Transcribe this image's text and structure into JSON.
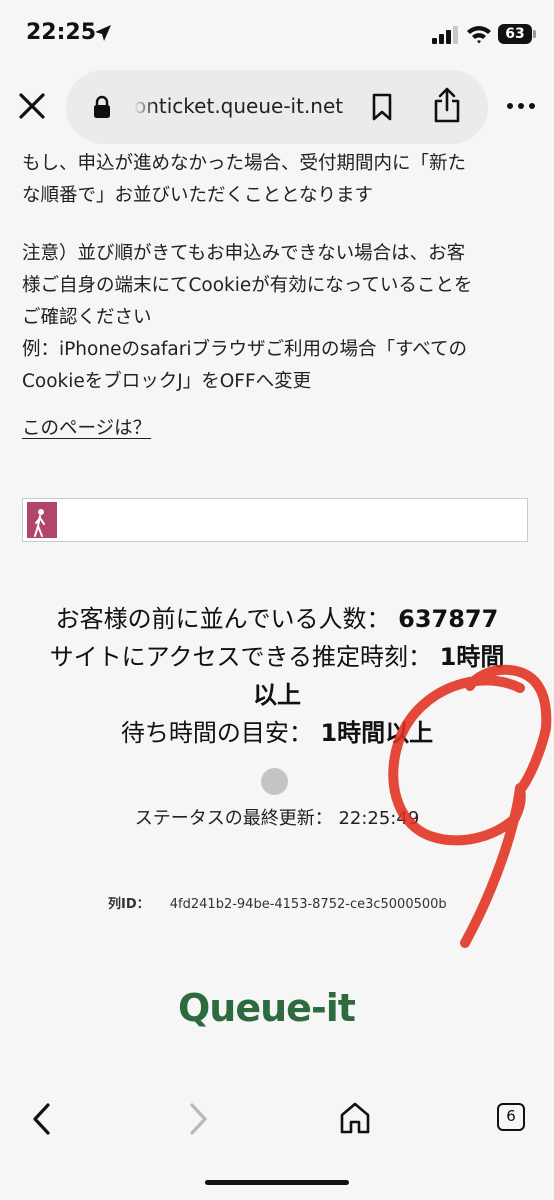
{
  "status_bar": {
    "time": "22:25",
    "battery": "63"
  },
  "browser": {
    "url": "onticket.queue-it.net",
    "tab_count": "6"
  },
  "page": {
    "paragraph1": [
      "もし、申込が進めなかった場合、受付期間内に「新た",
      "な順番で」お並びいただくこととなります"
    ],
    "paragraph2": [
      "注意）並び順がきてもお申込みできない場合は、お客",
      "様ご自身の端末にてCookieが有効になっていることを",
      "ご確認ください",
      "例：iPhoneのsafariブラウザご利用の場合「すべての",
      "CookieをブロックJ」をOFFへ変更"
    ],
    "help_link": "このページは？",
    "progress_fraction": 0.06,
    "queue": {
      "people_ahead_label": "お客様の前に並んでいる人数：",
      "people_ahead_value": "637877",
      "expected_access_label": "サイトにアクセスできる推定時刻：",
      "expected_access_value_part1": "1時間",
      "expected_access_value_part2": "以上",
      "wait_time_label": "待ち時間の目安：",
      "wait_time_value": "1時間以上"
    },
    "last_update_label": "ステータスの最終更新：",
    "last_update_time": "22:25:49",
    "queue_id_label": "列ID：",
    "queue_id_value": "4fd241b2-94be-4153-8752-ce3c5000500b",
    "logo_text": "Queue-it"
  },
  "colors": {
    "progress_fill": "#b2456b",
    "logo": "#2d6a3e",
    "marker": "#e0301e"
  },
  "icons": [
    "location-arrow-icon",
    "signal-icon",
    "wifi-icon",
    "close-icon",
    "lock-icon",
    "bookmark-icon",
    "share-icon",
    "more-icon",
    "walker-icon",
    "back-icon",
    "forward-icon",
    "home-icon"
  ]
}
